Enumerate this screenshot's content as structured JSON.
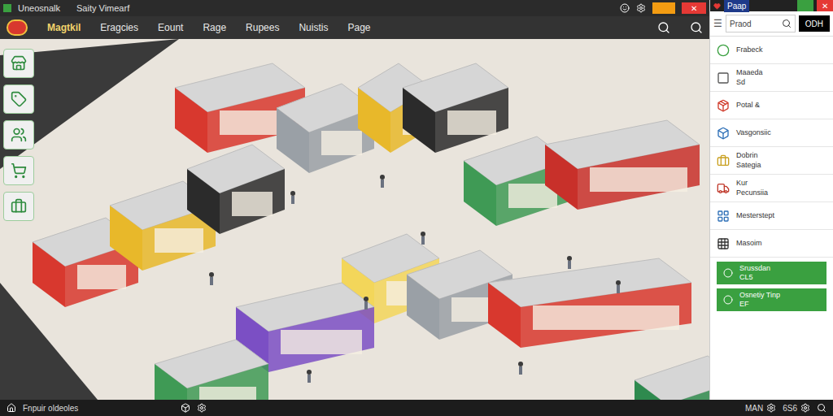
{
  "window": {
    "title": "Uneosnalk",
    "subtitle": "Saity Vimearf",
    "close": "✕"
  },
  "menu": [
    {
      "label": "Magtkil",
      "selected": true
    },
    {
      "label": "Eragcies",
      "selected": false
    },
    {
      "label": "Eount",
      "selected": false
    },
    {
      "label": "Rage",
      "selected": false
    },
    {
      "label": "Rupees",
      "selected": false
    },
    {
      "label": "Nuistis",
      "selected": false
    },
    {
      "label": "Page",
      "selected": false
    }
  ],
  "panel": {
    "title": "Paap",
    "close": "✕",
    "search": {
      "placeholder": "Praod"
    },
    "search_button": "ODH",
    "items": [
      {
        "label": "Frabeck",
        "sub": ""
      },
      {
        "label": "Maaeda",
        "sub": "Sd"
      },
      {
        "label": "Potal &",
        "sub": ""
      },
      {
        "label": "Vasgonsiic",
        "sub": ""
      },
      {
        "label": "Dobrin",
        "sub": "Sategia"
      },
      {
        "label": "Kur",
        "sub": "Pecunsiia"
      },
      {
        "label": "Mesterstept",
        "sub": ""
      },
      {
        "label": "Masoim",
        "sub": ""
      }
    ],
    "actions": [
      {
        "label": "Srussdan",
        "sub": "CL5"
      },
      {
        "label": "Osnetiy Tinp",
        "sub": "EF"
      }
    ]
  },
  "status_bar": {
    "left": "Fnpuir oldeoles",
    "right": [
      "MAN",
      "6S6"
    ]
  }
}
